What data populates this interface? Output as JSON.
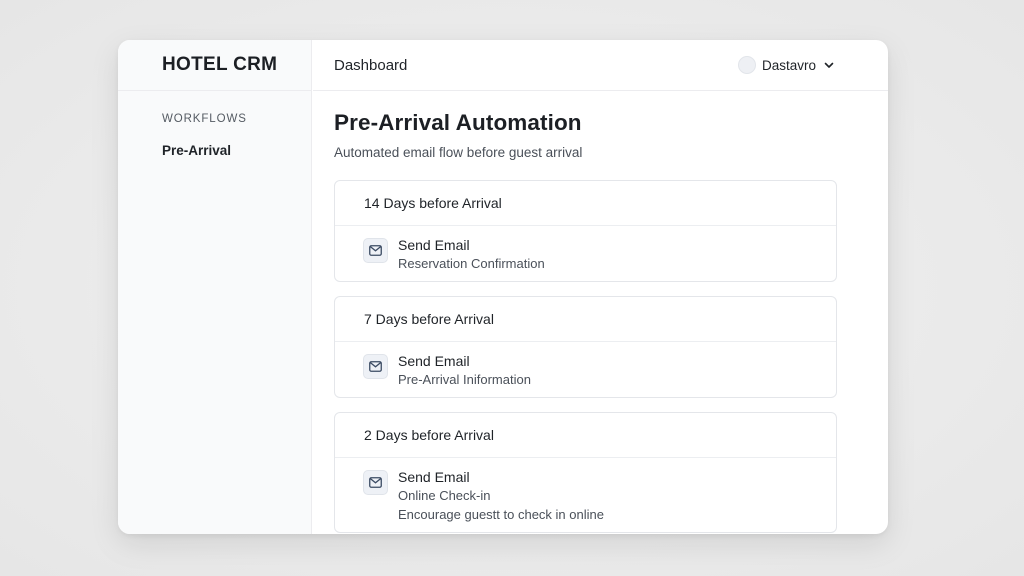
{
  "app": {
    "brand": "HOTEL CRM"
  },
  "header": {
    "title": "Dashboard",
    "user_name": "Dastavro"
  },
  "sidebar": {
    "section_title": "WORKFLOWS",
    "items": [
      {
        "label": "Pre-Arrival"
      }
    ]
  },
  "main": {
    "title": "Pre-Arrival Automation",
    "subtitle": "Automated email flow before guest arrival",
    "steps": [
      {
        "timing": "14 Days before Arrival",
        "action": "Send Email",
        "details": [
          "Reservation Confirmation"
        ]
      },
      {
        "timing": "7 Days before Arrival",
        "action": "Send Email",
        "details": [
          "Pre-Arrival Iniformation"
        ]
      },
      {
        "timing": "2 Days before Arrival",
        "action": "Send Email",
        "details": [
          "Online Check-in",
          "Encourage guestt to check in online"
        ]
      }
    ]
  },
  "icons": {
    "step_icon": "mail-icon",
    "user_menu": "chevron-down-icon"
  },
  "colors": {
    "window_bg": "#ffffff",
    "sidebar_bg": "#f9fafb",
    "icon_bg": "#eef1f6",
    "icon_stroke": "#3b4b63"
  }
}
